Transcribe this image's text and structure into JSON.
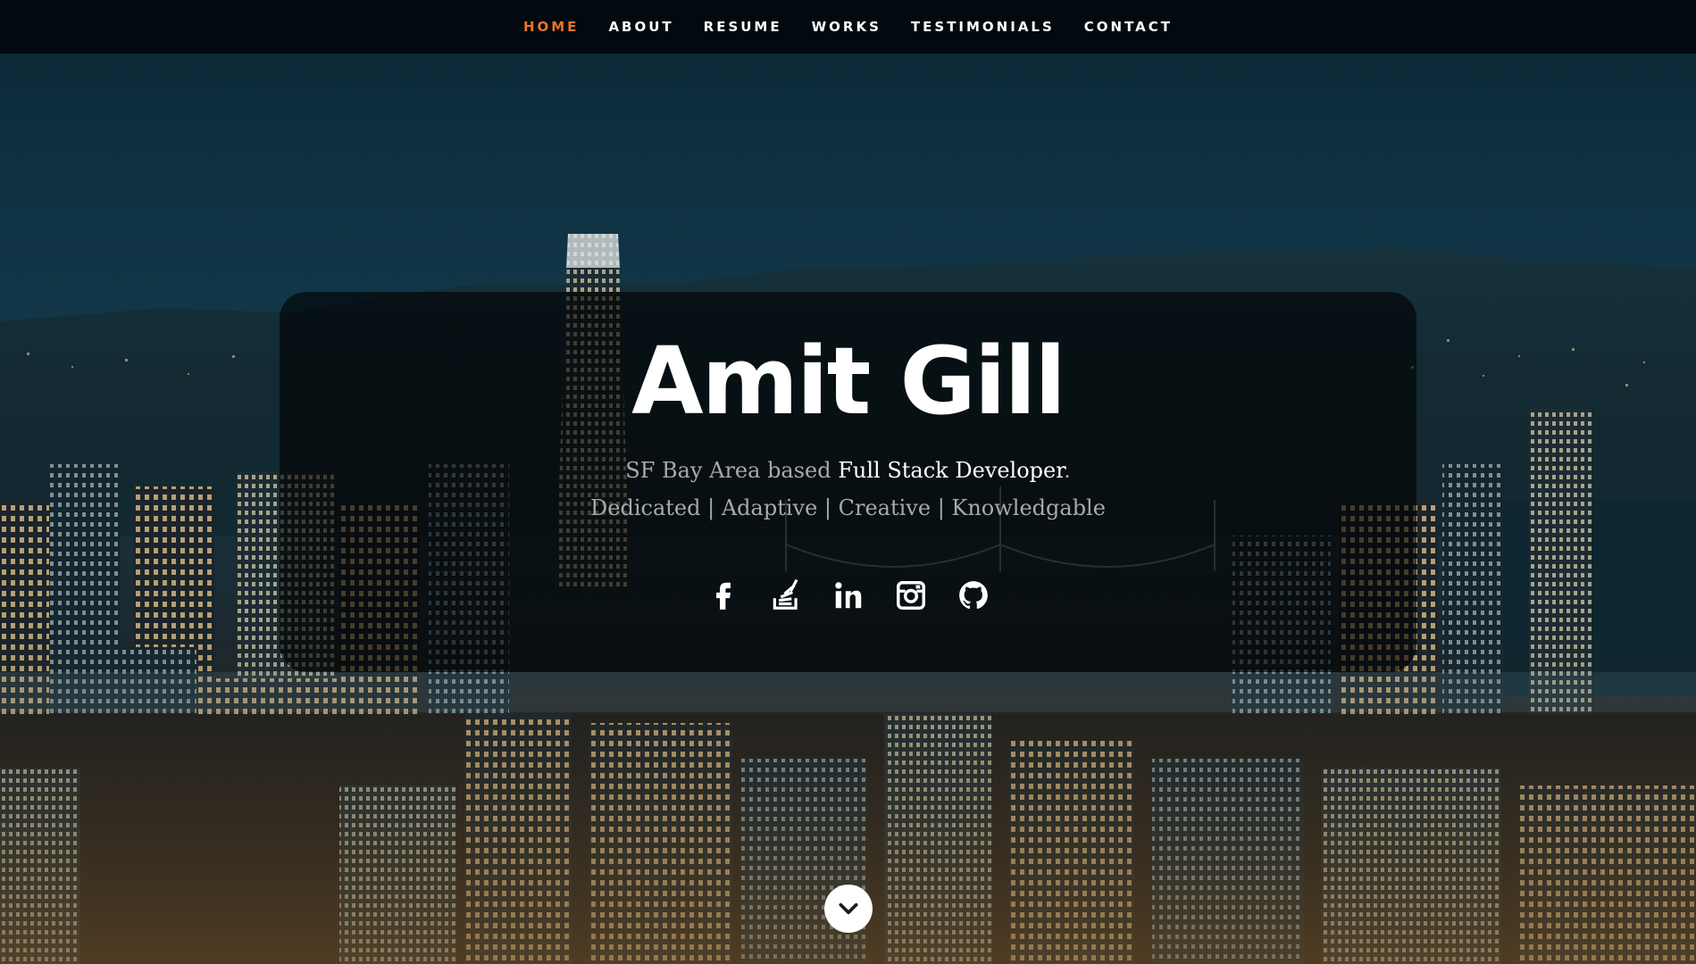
{
  "nav": {
    "items": [
      {
        "label": "HOME",
        "active": true
      },
      {
        "label": "ABOUT",
        "active": false
      },
      {
        "label": "RESUME",
        "active": false
      },
      {
        "label": "WORKS",
        "active": false
      },
      {
        "label": "TESTIMONIALS",
        "active": false
      },
      {
        "label": "CONTACT",
        "active": false
      }
    ],
    "active_color": "#e8742b"
  },
  "hero": {
    "name": "Amit Gill",
    "tagline_prefix": "SF Bay Area based ",
    "tagline_role": "Full Stack Developer",
    "tagline_suffix": ".",
    "traits": "Dedicated | Adaptive | Creative | Knowledgable"
  },
  "social": [
    {
      "icon": "facebook-icon"
    },
    {
      "icon": "stackoverflow-icon"
    },
    {
      "icon": "linkedin-icon"
    },
    {
      "icon": "instagram-icon"
    },
    {
      "icon": "github-icon"
    }
  ],
  "scroll_icon": "chevron-down-icon"
}
